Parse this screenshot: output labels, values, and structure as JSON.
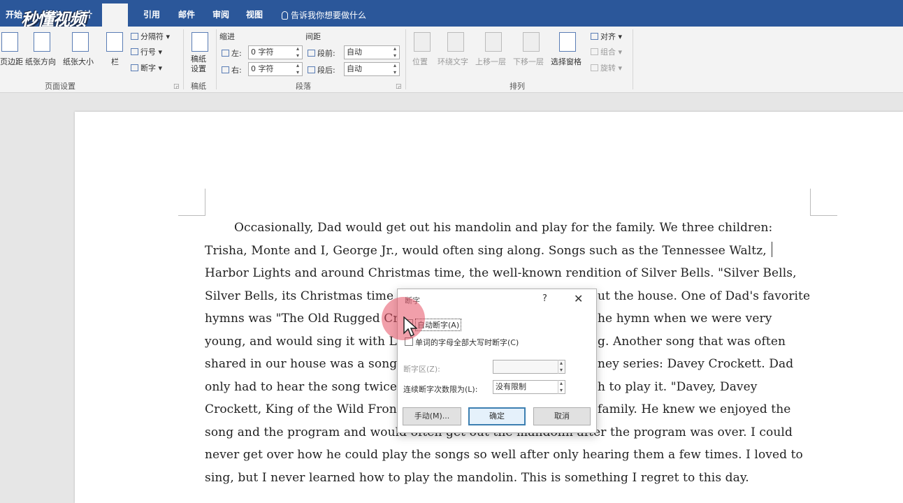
{
  "watermark": "秒懂视频",
  "tabs": [
    "开始",
    "插入",
    "设计",
    "引用",
    "邮件",
    "审阅",
    "视图"
  ],
  "tell_me": "告诉我你想要做什么",
  "ribbon": {
    "page_setup": {
      "margins": "页边距",
      "orientation": "纸张方向",
      "size": "纸张大小",
      "columns": "栏",
      "breaks": "分隔符",
      "line_numbers": "行号",
      "hyphenation": "断字",
      "label": "页面设置"
    },
    "draft": {
      "button": "稿纸\n设置",
      "label": "稿纸"
    },
    "paragraph": {
      "indent_header": "缩进",
      "spacing_header": "间距",
      "left_label": "左:",
      "left_value": "0 字符",
      "right_label": "右:",
      "right_value": "0 字符",
      "before_label": "段前:",
      "before_value": "自动",
      "after_label": "段后:",
      "after_value": "自动",
      "label": "段落"
    },
    "arrange": {
      "position": "位置",
      "wrap_text": "环绕文字",
      "bring_forward": "上移一层",
      "send_backward": "下移一层",
      "selection_pane": "选择窗格",
      "align": "对齐",
      "group": "组合",
      "rotate": "旋转",
      "label": "排列"
    }
  },
  "document": {
    "lines": [
      "Occasionally, Dad would get out his mandolin and play for the family. We three children:",
      "Trisha, Monte and I, George Jr., would often sing along. Songs such as the Tennessee Waltz,",
      "Harbor Lights and around Christmas time, the well-known rendition of Silver Bells. \"Silver Bells,",
      "Silver Bells, its Christmas time",
      "hymns was \"The Old Rugged Cr",
      "young, and would sing it with L",
      "shared in our house was a song",
      "only had to hear the song twice",
      "Crockett, King of the Wild Fron",
      "song and the program and would often get out the mandolin after the program was over. I could",
      "never get over how he could play the songs so well after only hearing them a few times. I loved to",
      "sing, but I never learned how to play the mandolin. This is something I regret to this day."
    ],
    "right_fragments": [
      "ut the house. One of Dad's favorite",
      "he hymn when we were very",
      "g. Another song that was often",
      "ney series: Davey Crockett. Dad",
      "h to play it. \"Davey, Davey",
      "family. He knew we enjoyed the"
    ]
  },
  "dialog": {
    "title": "断字",
    "help": "?",
    "close": "✕",
    "auto_hyphenate": "自动断字(A)",
    "hyphenate_caps": "单词的字母全部大写时断字(C)",
    "zone_label": "断字区(Z):",
    "zone_value": "",
    "limit_label": "连续断字次数限为(L):",
    "limit_value": "没有限制",
    "manual_button": "手动(M)...",
    "ok_button": "确定",
    "cancel_button": "取消"
  }
}
